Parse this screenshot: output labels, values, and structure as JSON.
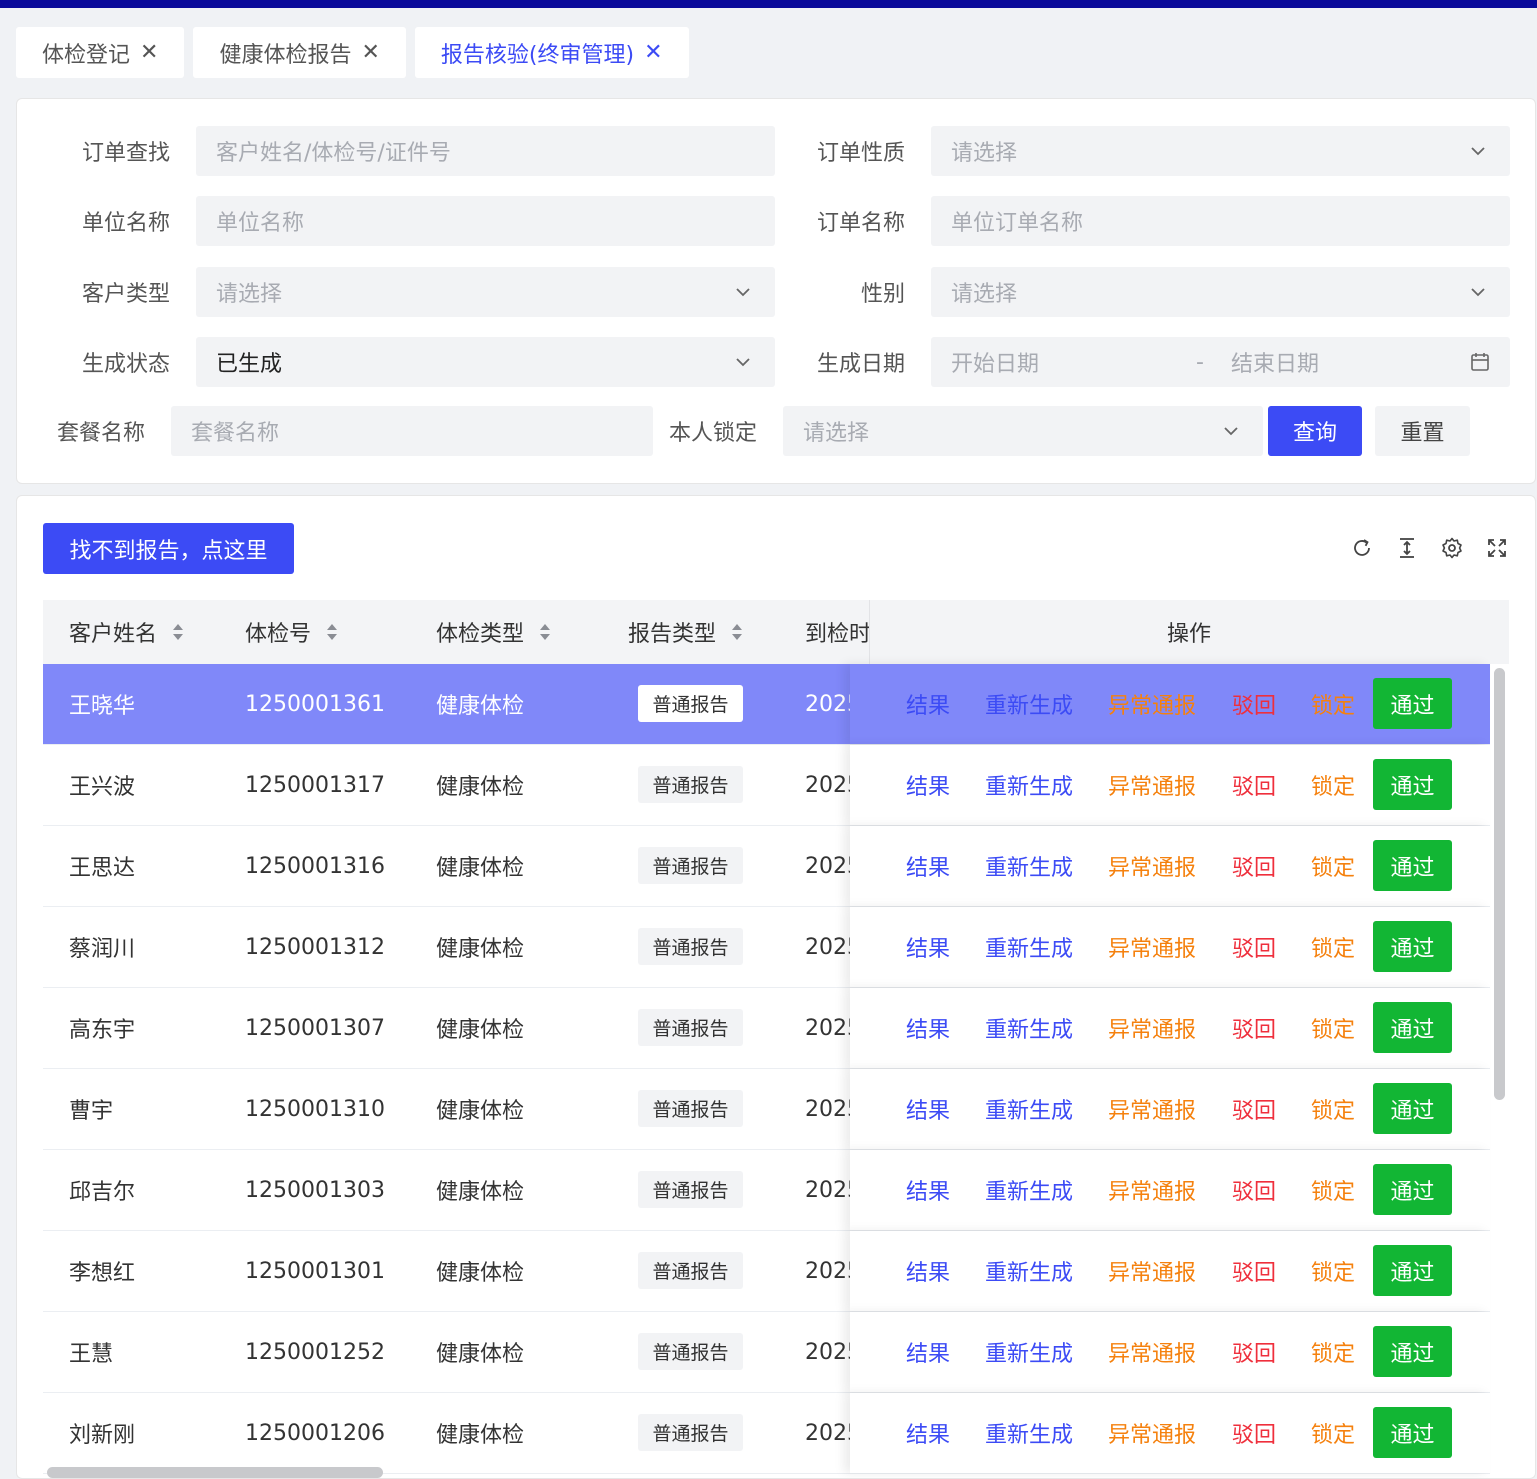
{
  "tabs": [
    {
      "label": "体检登记",
      "close": "✕"
    },
    {
      "label": "健康体检报告",
      "close": "✕"
    },
    {
      "label": "报告核验(终审管理)",
      "close": "✕"
    }
  ],
  "filters": {
    "order_search": {
      "label": "订单查找",
      "placeholder": "客户姓名/体检号/证件号"
    },
    "order_nature": {
      "label": "订单性质",
      "placeholder": "请选择"
    },
    "unit_name": {
      "label": "单位名称",
      "placeholder": "单位名称"
    },
    "order_name": {
      "label": "订单名称",
      "placeholder": "单位订单名称"
    },
    "customer_type": {
      "label": "客户类型",
      "placeholder": "请选择"
    },
    "gender": {
      "label": "性别",
      "placeholder": "请选择"
    },
    "gen_status": {
      "label": "生成状态",
      "value": "已生成"
    },
    "gen_date": {
      "label": "生成日期",
      "start_placeholder": "开始日期",
      "separator": "-",
      "end_placeholder": "结束日期"
    },
    "package_name": {
      "label": "套餐名称",
      "placeholder": "套餐名称"
    },
    "self_lock": {
      "label": "本人锁定",
      "placeholder": "请选择"
    },
    "query_label": "查询",
    "reset_label": "重置"
  },
  "toolbar": {
    "not_found_label": "找不到报告，点这里",
    "icons": [
      "refresh-icon",
      "column-height-icon",
      "settings-icon",
      "fullscreen-icon"
    ]
  },
  "table": {
    "columns": [
      "客户姓名",
      "体检号",
      "体检类型",
      "报告类型",
      "到检时",
      "操作"
    ],
    "actions": {
      "result": "结果",
      "regenerate": "重新生成",
      "abnormal": "异常通报",
      "reject": "驳回",
      "lock": "锁定",
      "pass": "通过"
    },
    "rows": [
      {
        "name": "王晓华",
        "id": "1250001361",
        "type": "健康体检",
        "report": "普通报告",
        "date": "2025"
      },
      {
        "name": "王兴波",
        "id": "1250001317",
        "type": "健康体检",
        "report": "普通报告",
        "date": "2025"
      },
      {
        "name": "王思达",
        "id": "1250001316",
        "type": "健康体检",
        "report": "普通报告",
        "date": "2025"
      },
      {
        "name": "蔡润川",
        "id": "1250001312",
        "type": "健康体检",
        "report": "普通报告",
        "date": "2025"
      },
      {
        "name": "高东宇",
        "id": "1250001307",
        "type": "健康体检",
        "report": "普通报告",
        "date": "2025"
      },
      {
        "name": "曹宇",
        "id": "1250001310",
        "type": "健康体检",
        "report": "普通报告",
        "date": "2025"
      },
      {
        "name": "邱吉尔",
        "id": "1250001303",
        "type": "健康体检",
        "report": "普通报告",
        "date": "2025"
      },
      {
        "name": "李想红",
        "id": "1250001301",
        "type": "健康体检",
        "report": "普通报告",
        "date": "2025"
      },
      {
        "name": "王慧",
        "id": "1250001252",
        "type": "健康体检",
        "report": "普通报告",
        "date": "2025"
      },
      {
        "name": "刘新刚",
        "id": "1250001206",
        "type": "健康体检",
        "report": "普通报告",
        "date": "2025"
      }
    ]
  },
  "colors": {
    "primary": "#3c4bf5",
    "selected_row": "#8088f9",
    "warning": "#f5810e",
    "danger": "#ef2f3c",
    "success": "#12b634"
  }
}
